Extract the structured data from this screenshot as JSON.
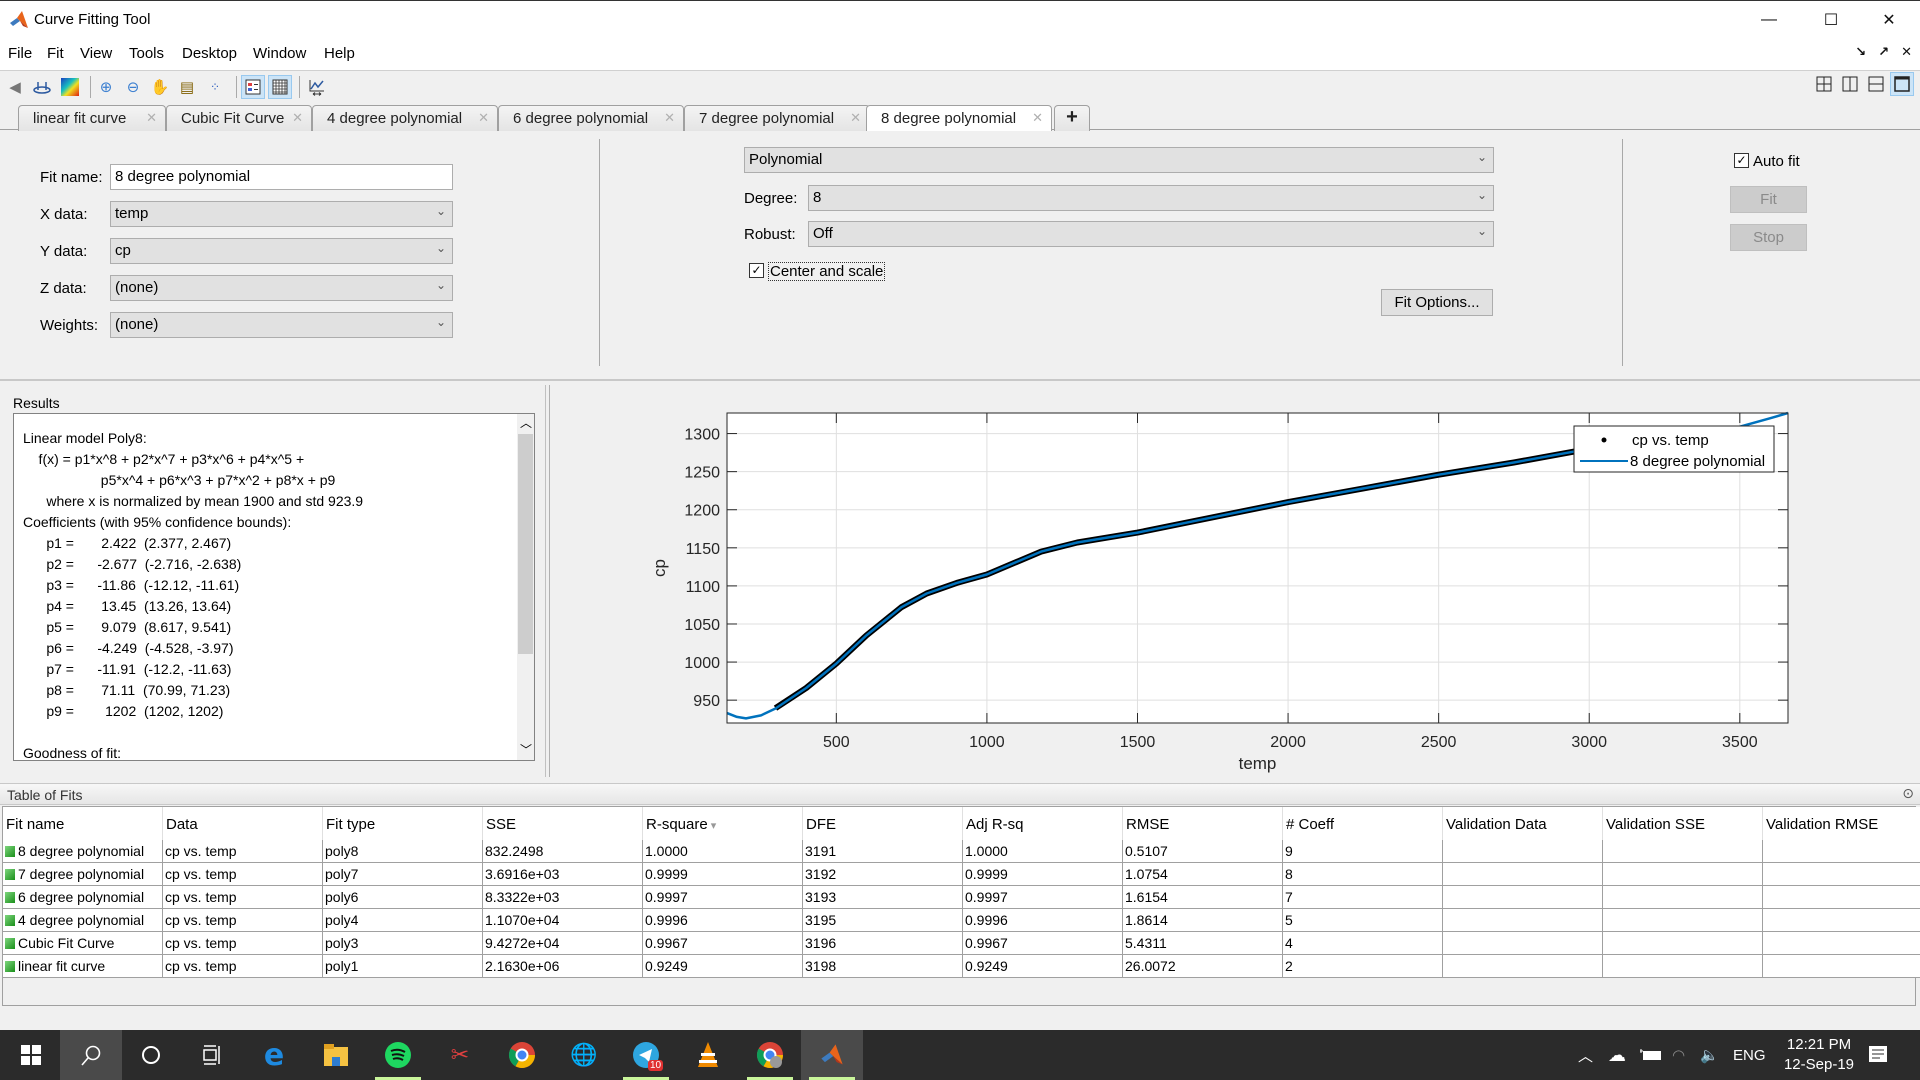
{
  "window": {
    "title": "Curve Fitting Tool",
    "controls": {
      "minimize": "—",
      "maximize": "☐",
      "close": "✕"
    }
  },
  "menu": [
    "File",
    "Fit",
    "View",
    "Tools",
    "Desktop",
    "Window",
    "Help"
  ],
  "toolbar": {
    "icons": [
      "back-icon",
      "data-cursor-icon",
      "colormap-icon",
      "zoom-in-icon",
      "zoom-out-icon",
      "pan-icon",
      "data-cursor-icon",
      "exclusion-icon",
      "legend-icon",
      "grid-icon",
      "axes-limits-icon"
    ],
    "layout_icons": [
      "tile-grid-icon",
      "tile-columns-icon",
      "tile-rows-icon",
      "single-view-icon"
    ]
  },
  "tabs": [
    {
      "label": "linear fit curve",
      "active": false
    },
    {
      "label": "Cubic Fit Curve",
      "active": false
    },
    {
      "label": "4 degree polynomial",
      "active": false
    },
    {
      "label": "6 degree polynomial",
      "active": false
    },
    {
      "label": "7 degree polynomial",
      "active": false
    },
    {
      "label": "8 degree polynomial",
      "active": true
    }
  ],
  "fit_panel": {
    "fit_name_label": "Fit name:",
    "fit_name_value": "8 degree polynomial",
    "x_data_label": "X data:",
    "x_data_value": "temp",
    "y_data_label": "Y data:",
    "y_data_value": "cp",
    "z_data_label": "Z data:",
    "z_data_value": "(none)",
    "weights_label": "Weights:",
    "weights_value": "(none)",
    "fit_type_value": "Polynomial",
    "degree_label": "Degree:",
    "degree_value": "8",
    "robust_label": "Robust:",
    "robust_value": "Off",
    "center_scale_label": "Center and scale",
    "center_scale_checked": true,
    "fit_options_label": "Fit Options...",
    "auto_fit_label": "Auto fit",
    "auto_fit_checked": true,
    "fit_button": "Fit",
    "stop_button": "Stop"
  },
  "results": {
    "title": "Results",
    "lines": [
      "Linear model Poly8:",
      "    f(x) = p1*x^8 + p2*x^7 + p3*x^6 + p4*x^5 +",
      "                    p5*x^4 + p6*x^3 + p7*x^2 + p8*x + p9",
      "      where x is normalized by mean 1900 and std 923.9",
      "Coefficients (with 95% confidence bounds):",
      "      p1 =       2.422  (2.377, 2.467)",
      "      p2 =      -2.677  (-2.716, -2.638)",
      "      p3 =      -11.86  (-12.12, -11.61)",
      "      p4 =       13.45  (13.26, 13.64)",
      "      p5 =       9.079  (8.617, 9.541)",
      "      p6 =      -4.249  (-4.528, -3.97)",
      "      p7 =      -11.91  (-12.2, -11.63)",
      "      p8 =       71.11  (70.99, 71.23)",
      "      p9 =        1202  (1202, 1202)",
      "",
      "Goodness of fit:"
    ]
  },
  "chart_data": {
    "type": "line",
    "title": "",
    "xlabel": "temp",
    "ylabel": "cp",
    "xlim": [
      137,
      3660
    ],
    "ylim": [
      920,
      1327
    ],
    "xticks": [
      500,
      1000,
      1500,
      2000,
      2500,
      3000,
      3500
    ],
    "yticks": [
      950,
      1000,
      1050,
      1100,
      1150,
      1200,
      1250,
      1300
    ],
    "grid": true,
    "legend": {
      "placement": "top-right",
      "entries": [
        "cp vs. temp",
        "8 degree polynomial"
      ]
    },
    "series": [
      {
        "name": "cp vs. temp",
        "style": "points",
        "color": "#000000",
        "x": [
          298,
          400,
          500,
          600,
          716,
          800,
          900,
          1000,
          1180,
          1300,
          1500,
          1750,
          2000,
          2250,
          2500,
          2750,
          3000
        ],
        "y": [
          939.5,
          966,
          998,
          1035,
          1072,
          1090,
          1104,
          1115,
          1145,
          1157,
          1170,
          1190,
          1210,
          1228,
          1246,
          1262,
          1280
        ]
      },
      {
        "name": "8 degree polynomial",
        "style": "line",
        "color": "#0072bd",
        "x": [
          137,
          170,
          200,
          250,
          298,
          400,
          500,
          600,
          716,
          800,
          900,
          1000,
          1180,
          1300,
          1500,
          1750,
          2000,
          2250,
          2500,
          2750,
          3000,
          3200,
          3400,
          3500,
          3600,
          3660
        ],
        "y": [
          933,
          928,
          926,
          930,
          939,
          966,
          998,
          1035,
          1072,
          1090,
          1104,
          1115,
          1145,
          1157,
          1170,
          1190,
          1210,
          1228,
          1246,
          1262,
          1280,
          1290,
          1300,
          1309,
          1320,
          1327
        ]
      }
    ]
  },
  "table_of_fits": {
    "title": "Table of Fits",
    "columns": [
      "Fit name",
      "Data",
      "Fit type",
      "SSE",
      "R-square",
      "DFE",
      "Adj R-sq",
      "RMSE",
      "# Coeff",
      "Validation Data",
      "Validation SSE",
      "Validation RMSE"
    ],
    "sorted_column": "R-square",
    "rows": [
      [
        "8 degree polynomial",
        "cp vs. temp",
        "poly8",
        "832.2498",
        "1.0000",
        "3191",
        "1.0000",
        "0.5107",
        "9",
        "",
        "",
        ""
      ],
      [
        "7 degree polynomial",
        "cp vs. temp",
        "poly7",
        "3.6916e+03",
        "0.9999",
        "3192",
        "0.9999",
        "1.0754",
        "8",
        "",
        "",
        ""
      ],
      [
        "6 degree polynomial",
        "cp vs. temp",
        "poly6",
        "8.3322e+03",
        "0.9997",
        "3193",
        "0.9997",
        "1.6154",
        "7",
        "",
        "",
        ""
      ],
      [
        "4 degree polynomial",
        "cp vs. temp",
        "poly4",
        "1.1070e+04",
        "0.9996",
        "3195",
        "0.9996",
        "1.8614",
        "5",
        "",
        "",
        ""
      ],
      [
        "Cubic Fit Curve",
        "cp vs. temp",
        "poly3",
        "9.4272e+04",
        "0.9967",
        "3196",
        "0.9967",
        "5.4311",
        "4",
        "",
        "",
        ""
      ],
      [
        "linear fit curve",
        "cp vs. temp",
        "poly1",
        "2.1630e+06",
        "0.9249",
        "3198",
        "0.9249",
        "26.0072",
        "2",
        "",
        "",
        ""
      ]
    ]
  },
  "taskbar": {
    "apps": [
      "windows-start-icon",
      "search-icon",
      "cortana-icon",
      "task-view-icon",
      "edge-icon",
      "file-explorer-icon",
      "spotify-icon",
      "snipping-tool-icon",
      "chrome-icon",
      "download-manager-icon",
      "telegram-icon",
      "vlc-icon",
      "chrome-profile-icon",
      "matlab-icon"
    ],
    "telegram_badge": "10",
    "language": "ENG",
    "time": "12:21 PM",
    "date": "12-Sep-19"
  }
}
